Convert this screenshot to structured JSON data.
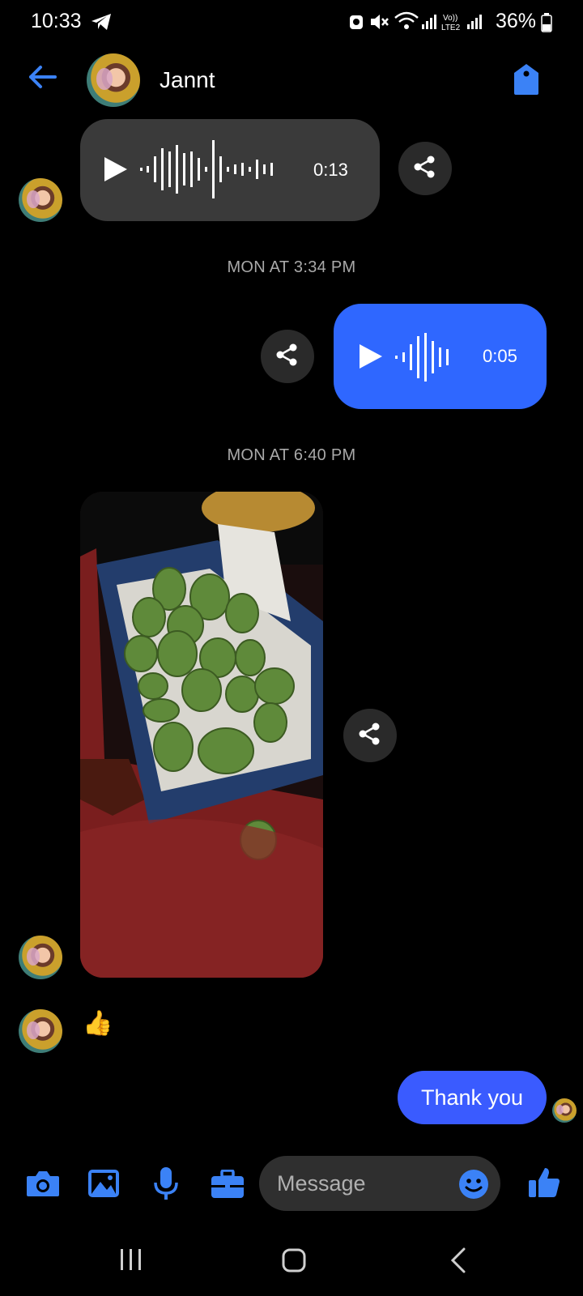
{
  "status_bar": {
    "time": "10:33",
    "battery": "36%"
  },
  "header": {
    "contact_name": "Jannt"
  },
  "thread": {
    "voice_msg_1": {
      "duration": "0:13"
    },
    "timestamp_1": "MON AT 3:34 PM",
    "voice_msg_2": {
      "duration": "0:05"
    },
    "timestamp_2": "MON AT 6:40 PM",
    "reaction_emoji": "👍",
    "sent_text": "Thank you"
  },
  "composer": {
    "placeholder": "Message"
  },
  "colors": {
    "accent": "#3a5bff",
    "icon_blue": "#3b82f6",
    "bubble_grey": "#3a3a3a"
  }
}
